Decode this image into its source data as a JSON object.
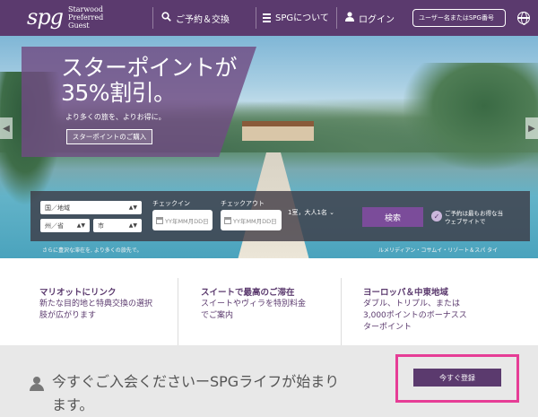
{
  "header": {
    "logo_main": "spg",
    "logo_line1": "Starwood",
    "logo_line2": "Preferred",
    "logo_line3": "Guest",
    "nav_reserve": "ご予約＆交換",
    "nav_about": "SPGについて",
    "nav_login": "ログイン",
    "member_placeholder": "ユーザー名またはSPG番号",
    "icons": {
      "search": "search-icon",
      "menu": "menu-icon",
      "user": "user-icon",
      "language": "globe-icon"
    }
  },
  "promo": {
    "title_line1": "スターポイントが",
    "title_line2": "35%割引。",
    "subtitle": "より多くの旅を、よりお得に。",
    "button": "スターポイントのご購入"
  },
  "booking": {
    "country": "国／地域",
    "state": "州／省",
    "city": "市",
    "checkin_label": "チェックイン",
    "checkin_placeholder": "YY年MM月DD日",
    "checkout_label": "チェックアウト",
    "checkout_placeholder": "YY年MM月DD日",
    "guests": "1室，大人1名",
    "search_button": "検索",
    "best_rate_text": "ご予約は最もお得な当ウェブサイトで",
    "caption_left": "さらに豊沢な滞在を, より多くの旅先で。",
    "caption_right": "ルメリディアン・コサムイ・リゾート＆スパ タイ"
  },
  "features": [
    {
      "title": "マリオットにリンク",
      "text": "新たな目的地と特典交換の選択肢が広がります"
    },
    {
      "title": "スイートで最高のご滞在",
      "text": "スイートやヴィラを特別料金でご案内"
    },
    {
      "title": "ヨーロッパ＆中東地域",
      "text": "ダブル、トリプル、または3,000ポイントのボーナススターポイント"
    }
  ],
  "join": {
    "text": "今すぐご入会くださいーSPGライフが始まります。",
    "button": "今すぐ登録"
  },
  "colors": {
    "brand": "#5b3a6e",
    "accent": "#7b4c9a",
    "highlight": "#e63d96"
  }
}
